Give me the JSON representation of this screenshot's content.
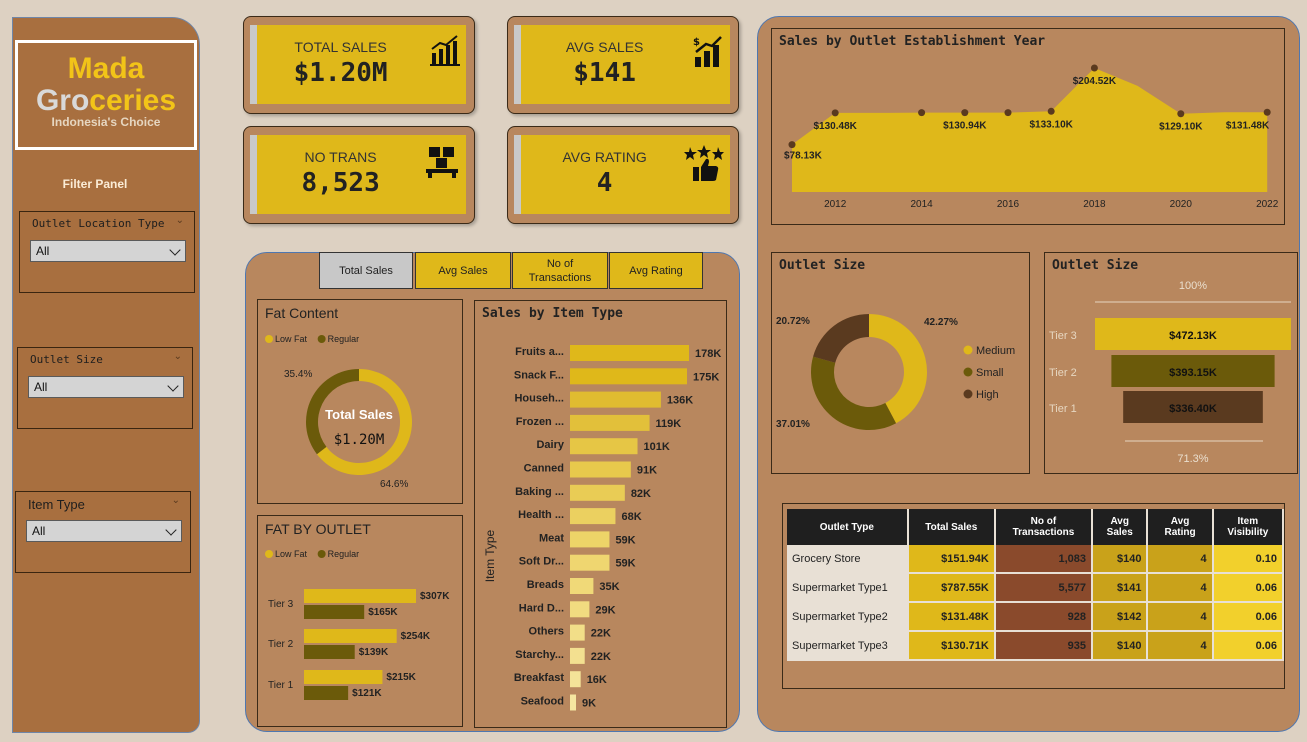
{
  "brand": {
    "line1": "Mada",
    "line2a": "Gro",
    "line2b": "ceries",
    "tagline": "Indonesia's Choice"
  },
  "filters": {
    "title": "Filter Panel",
    "location": {
      "label": "Outlet Location Type",
      "value": "All"
    },
    "size": {
      "label": "Outlet Size",
      "value": "All"
    },
    "item": {
      "label": "Item Type",
      "value": "All"
    }
  },
  "kpis": [
    {
      "title": "TOTAL SALES",
      "value": "$1.20M",
      "icon": "bar-chart-icon"
    },
    {
      "title": "AVG SALES",
      "value": "$141",
      "icon": "growth-chart-icon"
    },
    {
      "title": "NO TRANS",
      "value": "8,523",
      "icon": "boxes-icon"
    },
    {
      "title": "AVG RATING",
      "value": "4",
      "icon": "rating-thumbs-icon"
    }
  ],
  "tabs": [
    "Total Sales",
    "Avg Sales",
    "No of\nTransactions",
    "Avg Rating"
  ],
  "colors": {
    "yellow": "#dfb81a",
    "olive": "#6b5a0a",
    "brown": "#5a3a1f",
    "panel": "#b8875e"
  },
  "fat_content": {
    "title": "Fat Content",
    "legend": [
      "Low Fat",
      "Regular"
    ],
    "center_title": "Total Sales",
    "center_value": "$1.20M",
    "chart_data": {
      "type": "pie",
      "labels": [
        "Low Fat",
        "Regular"
      ],
      "values": [
        64.6,
        35.4
      ],
      "value_labels": [
        "64.6%",
        "35.4%"
      ]
    }
  },
  "fat_outlet": {
    "title": "FAT BY OUTLET",
    "legend": [
      "Low Fat",
      "Regular"
    ],
    "chart_data": {
      "type": "bar",
      "categories": [
        "Tier 3",
        "Tier 2",
        "Tier 1"
      ],
      "series": [
        {
          "name": "Low Fat",
          "values": [
            307,
            254,
            215
          ],
          "labels": [
            "$307K",
            "$254K",
            "$215K"
          ]
        },
        {
          "name": "Regular",
          "values": [
            165,
            139,
            121
          ],
          "labels": [
            "$165K",
            "$139K",
            "$121K"
          ]
        }
      ]
    }
  },
  "item_type": {
    "title": "Sales by Item Type",
    "ylabel": "Item Type",
    "chart_data": {
      "type": "bar",
      "categories": [
        "Fruits a...",
        "Snack F...",
        "Househ...",
        "Frozen ...",
        "Dairy",
        "Canned",
        "Baking ...",
        "Health ...",
        "Meat",
        "Soft Dr...",
        "Breads",
        "Hard D...",
        "Others",
        "Starchy...",
        "Breakfast",
        "Seafood"
      ],
      "values": [
        178,
        175,
        136,
        119,
        101,
        91,
        82,
        68,
        59,
        59,
        35,
        29,
        22,
        22,
        16,
        9
      ],
      "labels": [
        "178K",
        "175K",
        "136K",
        "119K",
        "101K",
        "91K",
        "82K",
        "68K",
        "59K",
        "59K",
        "35K",
        "29K",
        "22K",
        "22K",
        "16K",
        "9K"
      ]
    }
  },
  "year_chart": {
    "title": "Sales by Outlet Establishment Year",
    "chart_data": {
      "type": "area",
      "x": [
        2011,
        2012,
        2013,
        2014,
        2015,
        2016,
        2017,
        2018,
        2019,
        2020,
        2021,
        2022
      ],
      "values": [
        78.13,
        130.48,
        130.48,
        130.94,
        130.94,
        130.94,
        133.1,
        204.52,
        175,
        129.1,
        131.48,
        131.48
      ],
      "point_x": [
        2011,
        2012,
        2014,
        2015,
        2016,
        2017,
        2018,
        2020,
        2022
      ],
      "point_labels": [
        [
          2011,
          78.13,
          "$78.13K"
        ],
        [
          2012,
          130.48,
          "$130.48K"
        ],
        [
          2015,
          130.94,
          "$130.94K"
        ],
        [
          2017,
          133.1,
          "$133.10K"
        ],
        [
          2018,
          204.52,
          "$204.52K"
        ],
        [
          2020,
          129.1,
          "$129.10K"
        ],
        [
          2022,
          131.48,
          "$131.48K"
        ]
      ],
      "xticks": [
        "2012",
        "2014",
        "2016",
        "2018",
        "2020",
        "2022"
      ]
    }
  },
  "outlet_donut": {
    "title": "Outlet Size",
    "legend": [
      "Medium",
      "Small",
      "High"
    ],
    "chart_data": {
      "type": "pie",
      "labels": [
        "Medium",
        "Small",
        "High"
      ],
      "values": [
        42.27,
        37.01,
        20.72
      ],
      "value_labels": [
        "42.27%",
        "37.01%",
        "20.72%"
      ]
    }
  },
  "outlet_funnel": {
    "title": "Outlet Size",
    "top_pct": "100%",
    "bottom_pct": "71.3%",
    "chart_data": {
      "type": "bar",
      "categories": [
        "Tier 3",
        "Tier 2",
        "Tier 1"
      ],
      "values": [
        472.13,
        393.15,
        336.4
      ],
      "labels": [
        "$472.13K",
        "$393.15K",
        "$336.40K"
      ]
    }
  },
  "outlet_table": {
    "headers": [
      "Outlet Type",
      "Total Sales",
      "No of\nTransactions",
      "Avg\nSales",
      "Avg\nRating",
      "Item\nVisibility"
    ],
    "rows": [
      [
        "Grocery Store",
        "$151.94K",
        "1,083",
        "$140",
        "4",
        "0.10"
      ],
      [
        "Supermarket Type1",
        "$787.55K",
        "5,577",
        "$141",
        "4",
        "0.06"
      ],
      [
        "Supermarket Type2",
        "$131.48K",
        "928",
        "$142",
        "4",
        "0.06"
      ],
      [
        "Supermarket Type3",
        "$130.71K",
        "935",
        "$140",
        "4",
        "0.06"
      ]
    ]
  }
}
